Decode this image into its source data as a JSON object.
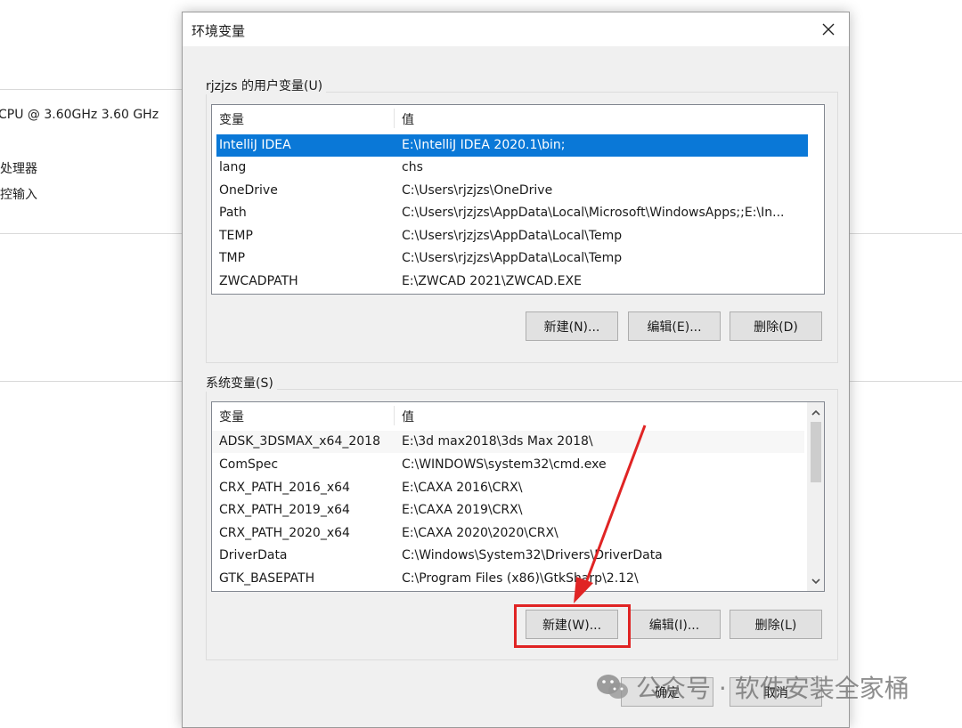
{
  "background": {
    "cpu_text": "CPU @ 3.60GHz   3.60 GHz",
    "processor_text": "处理器",
    "input_text": "控输入"
  },
  "dialog": {
    "title": "环境变量",
    "user_vars": {
      "label": "rjzjzs 的用户变量(U)",
      "columns": [
        "变量",
        "值"
      ],
      "rows": [
        {
          "name": "IntelliJ IDEA",
          "value": "E:\\IntelliJ IDEA 2020.1\\bin;",
          "selected": true
        },
        {
          "name": "lang",
          "value": "chs"
        },
        {
          "name": "OneDrive",
          "value": "C:\\Users\\rjzjzs\\OneDrive"
        },
        {
          "name": "Path",
          "value": "C:\\Users\\rjzjzs\\AppData\\Local\\Microsoft\\WindowsApps;;E:\\In..."
        },
        {
          "name": "TEMP",
          "value": "C:\\Users\\rjzjzs\\AppData\\Local\\Temp"
        },
        {
          "name": "TMP",
          "value": "C:\\Users\\rjzjzs\\AppData\\Local\\Temp"
        },
        {
          "name": "ZWCADPATH",
          "value": "E:\\ZWCAD 2021\\ZWCAD.EXE"
        }
      ],
      "buttons": {
        "new": "新建(N)...",
        "edit": "编辑(E)...",
        "delete": "删除(D)"
      }
    },
    "system_vars": {
      "label": "系统变量(S)",
      "columns": [
        "变量",
        "值"
      ],
      "rows": [
        {
          "name": "ADSK_3DSMAX_x64_2018",
          "value": "E:\\3d max2018\\3ds Max 2018\\"
        },
        {
          "name": "ComSpec",
          "value": "C:\\WINDOWS\\system32\\cmd.exe"
        },
        {
          "name": "CRX_PATH_2016_x64",
          "value": "E:\\CAXA 2016\\CRX\\"
        },
        {
          "name": "CRX_PATH_2019_x64",
          "value": "E:\\CAXA 2019\\CRX\\"
        },
        {
          "name": "CRX_PATH_2020_x64",
          "value": "E:\\CAXA 2020\\2020\\CRX\\"
        },
        {
          "name": "DriverData",
          "value": "C:\\Windows\\System32\\Drivers\\DriverData"
        },
        {
          "name": "GTK_BASEPATH",
          "value": "C:\\Program Files (x86)\\GtkSharp\\2.12\\"
        }
      ],
      "buttons": {
        "new": "新建(W)...",
        "edit": "编辑(I)...",
        "delete": "删除(L)"
      }
    },
    "footer": {
      "ok": "确定",
      "cancel": "取消"
    }
  },
  "watermark": {
    "text": "公众号 · 软件安装全家桶"
  },
  "colors": {
    "selection": "#0a78d7",
    "highlight": "#e02424"
  }
}
